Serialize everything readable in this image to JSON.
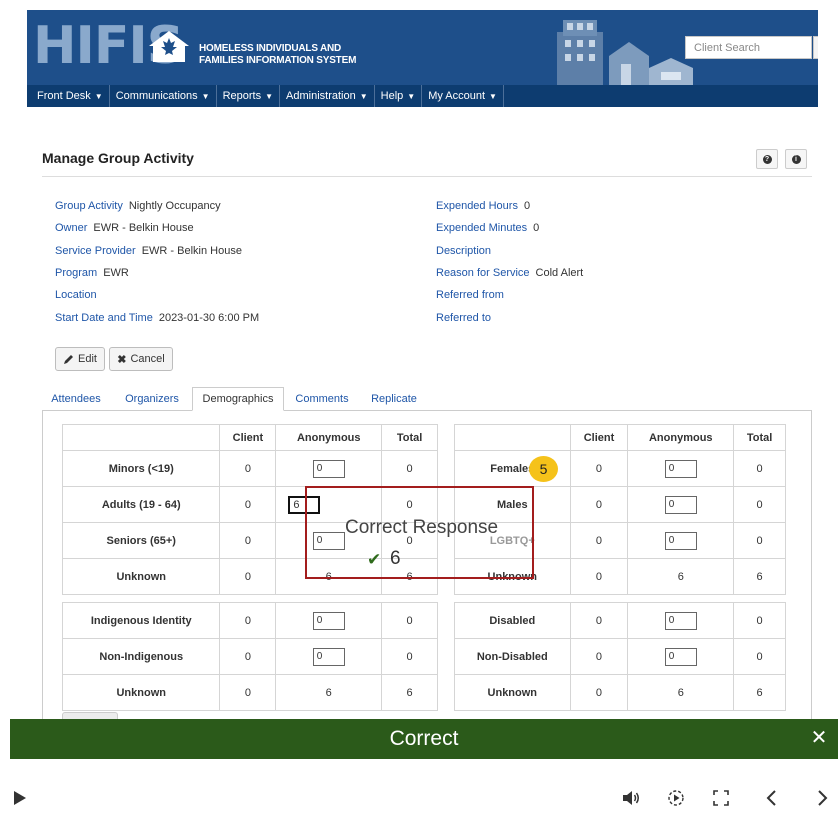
{
  "header": {
    "logo_text": "HIFIS",
    "brand_line1": "HOMELESS INDIVIDUALS AND",
    "brand_line2": "FAMILIES INFORMATION SYSTEM",
    "search_placeholder": "Client Search"
  },
  "nav": {
    "items": [
      {
        "label": "Front Desk"
      },
      {
        "label": "Communications"
      },
      {
        "label": "Reports"
      },
      {
        "label": "Administration"
      },
      {
        "label": "Help"
      },
      {
        "label": "My Account"
      }
    ]
  },
  "page": {
    "title": "Manage Group Activity"
  },
  "details": {
    "left": [
      {
        "key": "Group Activity",
        "value": "Nightly Occupancy"
      },
      {
        "key": "Owner",
        "value": "EWR - Belkin House"
      },
      {
        "key": "Service Provider",
        "value": "EWR - Belkin House"
      },
      {
        "key": "Program",
        "value": "EWR"
      },
      {
        "key": "Location",
        "value": ""
      },
      {
        "key": "Start Date and Time",
        "value": "2023-01-30 6:00 PM"
      }
    ],
    "right": [
      {
        "key": "Expended Hours",
        "value": "0"
      },
      {
        "key": "Expended Minutes",
        "value": "0"
      },
      {
        "key": "Description",
        "value": ""
      },
      {
        "key": "Reason for Service",
        "value": "Cold Alert"
      },
      {
        "key": "Referred from",
        "value": ""
      },
      {
        "key": "Referred to",
        "value": ""
      }
    ]
  },
  "actions": {
    "edit_label": "Edit",
    "cancel_label": "Cancel"
  },
  "tabs": [
    {
      "label": "Attendees"
    },
    {
      "label": "Organizers"
    },
    {
      "label": "Demographics"
    },
    {
      "label": "Comments"
    },
    {
      "label": "Replicate"
    }
  ],
  "demographics": {
    "headers": {
      "client": "Client",
      "anonymous": "Anonymous",
      "total": "Total"
    },
    "left": [
      {
        "label": "Minors (<19)",
        "client": "0",
        "anon": "0",
        "total": "0"
      },
      {
        "label": "Adults (19 - 64)",
        "client": "0",
        "anon": "6",
        "total": "0"
      },
      {
        "label": "Seniors (65+)",
        "client": "0",
        "anon": "0",
        "total": "0"
      },
      {
        "label": "Unknown",
        "client": "0",
        "anon": "6",
        "total": "6"
      },
      {
        "label": "Indigenous Identity",
        "client": "0",
        "anon": "0",
        "total": "0"
      },
      {
        "label": "Non-Indigenous",
        "client": "0",
        "anon": "0",
        "total": "0"
      },
      {
        "label": "Unknown",
        "client": "0",
        "anon": "6",
        "total": "6"
      }
    ],
    "right": [
      {
        "label": "Females",
        "client": "0",
        "anon": "0",
        "total": "0"
      },
      {
        "label": "Males",
        "client": "0",
        "anon": "0",
        "total": "0"
      },
      {
        "label": "LGBTQ+",
        "client": "0",
        "anon": "0",
        "total": "0"
      },
      {
        "label": "Unknown",
        "client": "0",
        "anon": "6",
        "total": "6"
      },
      {
        "label": "Disabled",
        "client": "0",
        "anon": "0",
        "total": "0"
      },
      {
        "label": "Non-Disabled",
        "client": "0",
        "anon": "0",
        "total": "0"
      },
      {
        "label": "Unknown",
        "client": "0",
        "anon": "6",
        "total": "6"
      }
    ]
  },
  "feedback": {
    "title": "Correct Response",
    "value": "6",
    "step_number": "5",
    "banner_text": "Correct"
  },
  "colors": {
    "header_bg": "#1e4f8a",
    "nav_bg": "#0d3c70",
    "link": "#1f56a8",
    "banner_bg": "#2b5a1a",
    "feedback_border": "#a31d1d",
    "badge": "#f5c21a"
  }
}
